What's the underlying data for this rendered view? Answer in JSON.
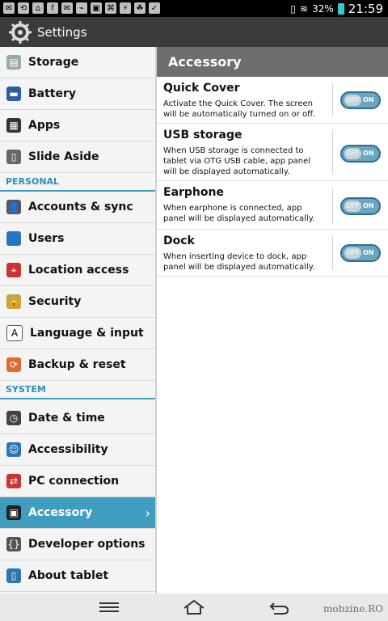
{
  "status": {
    "battery": "32%",
    "time": "21:59"
  },
  "app": {
    "title": "Settings"
  },
  "sidebar": {
    "items": [
      {
        "label": "Storage",
        "icon": "storage-icon"
      },
      {
        "label": "Battery",
        "icon": "battery-icon"
      },
      {
        "label": "Apps",
        "icon": "apps-icon"
      },
      {
        "label": "Slide Aside",
        "icon": "slide-aside-icon"
      },
      {
        "label": "Accounts & sync",
        "icon": "accounts-icon"
      },
      {
        "label": "Users",
        "icon": "users-icon"
      },
      {
        "label": "Location access",
        "icon": "location-icon"
      },
      {
        "label": "Security",
        "icon": "lock-icon"
      },
      {
        "label": "Language & input",
        "icon": "language-icon"
      },
      {
        "label": "Backup & reset",
        "icon": "backup-icon"
      },
      {
        "label": "Date & time",
        "icon": "clock-icon"
      },
      {
        "label": "Accessibility",
        "icon": "accessibility-icon"
      },
      {
        "label": "PC connection",
        "icon": "pc-connection-icon"
      },
      {
        "label": "Accessory",
        "icon": "accessory-icon",
        "selected": true
      },
      {
        "label": "Developer options",
        "icon": "developer-icon"
      },
      {
        "label": "About tablet",
        "icon": "about-icon"
      }
    ],
    "personal_header": "PERSONAL",
    "system_header": "SYSTEM"
  },
  "detail": {
    "title": "Accessory",
    "rows": [
      {
        "title": "Quick Cover",
        "desc": "Activate the Quick Cover. The screen will be automatically turned on or off."
      },
      {
        "title": "USB storage",
        "desc": "When USB storage is connected to tablet via OTG USB cable, app panel will be displayed automatically."
      },
      {
        "title": "Earphone",
        "desc": "When earphone is connected, app panel will be displayed automatically."
      },
      {
        "title": "Dock",
        "desc": "When inserting device to dock, app panel will be displayed automatically."
      }
    ],
    "toggle_off": "OFF",
    "toggle_on": "ON"
  },
  "watermark": "mobzine.RO"
}
